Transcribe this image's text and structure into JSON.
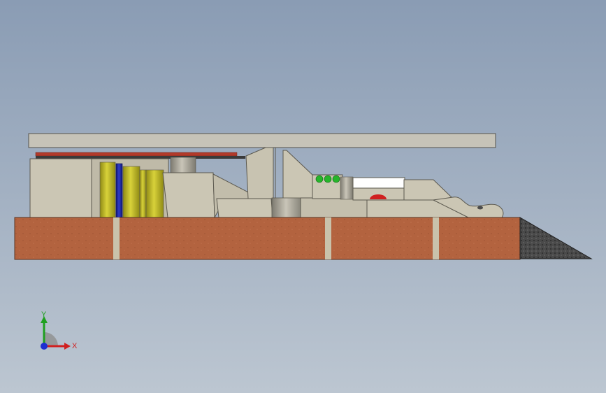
{
  "viewport": {
    "background_top": "#8a9cb4",
    "background_bottom": "#bcc6d1"
  },
  "model": {
    "colors": {
      "top_plate": "#c6c3b8",
      "body": "#cbc6b4",
      "body_shadow": "#a9a596",
      "brick": "#b3633f",
      "mortar": "#c9c2ab",
      "ramp": "#4a4a4a",
      "cylinder_yellow": "#bdb526",
      "cylinder_blue": "#1f2aa6",
      "led_red": "#b13a2a",
      "led_green": "#26b52b",
      "white_block": "#ffffff",
      "red_dome": "#d02020"
    }
  },
  "triad": {
    "x_label": "X",
    "y_label": "Y",
    "colors": {
      "x": "#d02020",
      "y": "#1fa01f",
      "z": "#1f2fd0"
    }
  }
}
